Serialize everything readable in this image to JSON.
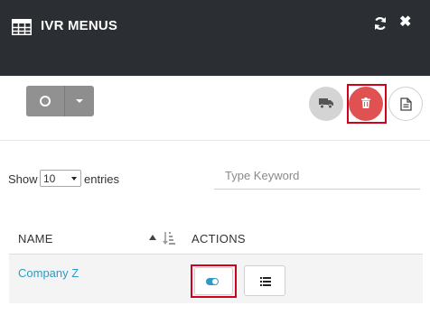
{
  "header": {
    "title": "IVR MENUS",
    "icons": [
      "grid-icon",
      "refresh-icon",
      "close-icon"
    ],
    "background": "#2b2e33"
  },
  "toolbar": {
    "split_button_icons": [
      "circle-icon",
      "caret-down-icon"
    ],
    "action_icons": [
      "truck-icon",
      "trash-icon",
      "document-icon"
    ],
    "delete_color": "#e05151"
  },
  "table_controls": {
    "show_label": "Show",
    "entries_value": "10",
    "entries_label": "entries",
    "search_placeholder": "Type Keyword"
  },
  "table": {
    "columns": [
      "NAME",
      "ACTIONS"
    ],
    "rows": [
      {
        "name": "Company Z",
        "toggle_on": true
      }
    ],
    "link_color": "#2f9bc4"
  },
  "highlight_color": "#d0021b"
}
